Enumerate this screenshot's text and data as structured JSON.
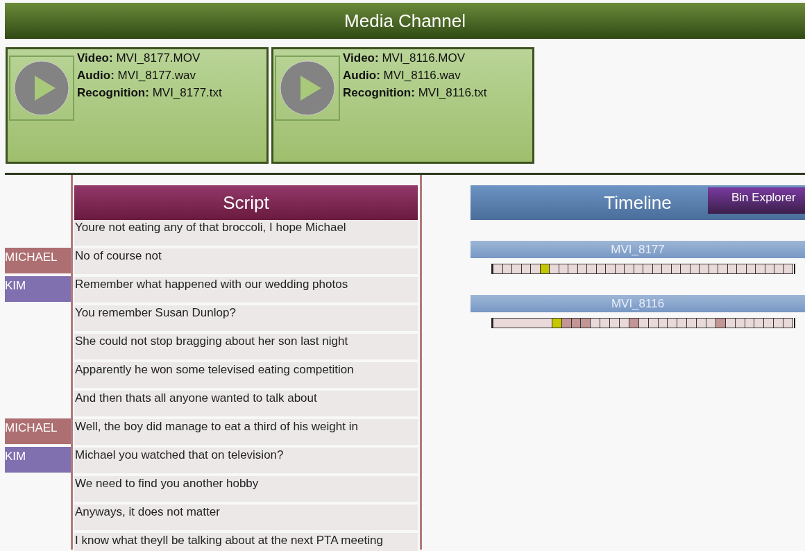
{
  "title": "Media Channel",
  "media": [
    {
      "video": "MVI_8177.MOV",
      "audio": "MVI_8177.wav",
      "recognition": "MVI_8177.txt",
      "video_label": "Video:",
      "audio_label": "Audio:",
      "recognition_label": "Recognition:"
    },
    {
      "video": "MVI_8116.MOV",
      "audio": "MVI_8116.wav",
      "recognition": "MVI_8116.txt",
      "video_label": "Video:",
      "audio_label": "Audio:",
      "recognition_label": "Recognition:"
    }
  ],
  "script": {
    "title": "Script",
    "lines": [
      {
        "text": "Youre not eating any of that broccoli, I hope Michael"
      },
      {
        "speaker": "MICHAEL",
        "color": "#ad6f71",
        "text": "No of course not"
      },
      {
        "speaker": "KIM",
        "color": "#8070b0",
        "text": "Remember what happened with our wedding photos"
      },
      {
        "text": "You remember Susan Dunlop?"
      },
      {
        "text": "She could not stop bragging about her son last night"
      },
      {
        "text": "Apparently he won some televised eating competition"
      },
      {
        "text": "And then thats all anyone wanted to talk about"
      },
      {
        "speaker": "MICHAEL",
        "color": "#ad6f71",
        "text": "Well, the boy did manage to eat a third of his weight in"
      },
      {
        "speaker": "KIM",
        "color": "#8070b0",
        "text": "Michael you watched that on television?"
      },
      {
        "text": "We need to find you another hobby"
      },
      {
        "text": "Anyways, it does not matter"
      },
      {
        "text": "I know what theyll be talking about at the next PTA meeting"
      }
    ]
  },
  "timeline": {
    "title": "Timeline",
    "bin_explorer": "Bin Explorer",
    "tracks": [
      {
        "name": "MVI_8177",
        "segments": [
          {
            "kind": "cell",
            "selected": false,
            "marked": false
          },
          {
            "kind": "cell",
            "selected": false,
            "marked": false
          },
          {
            "kind": "cell",
            "selected": false,
            "marked": false
          },
          {
            "kind": "cell",
            "selected": false,
            "marked": false
          },
          {
            "kind": "cell",
            "selected": false,
            "marked": false
          },
          {
            "kind": "cell",
            "selected": true,
            "marked": false
          },
          {
            "kind": "cell",
            "selected": false,
            "marked": false
          },
          {
            "kind": "cell",
            "selected": false,
            "marked": false
          },
          {
            "kind": "cell",
            "selected": false,
            "marked": false
          },
          {
            "kind": "cell",
            "selected": false,
            "marked": false
          },
          {
            "kind": "cell",
            "selected": false,
            "marked": false
          },
          {
            "kind": "cell",
            "selected": false,
            "marked": false
          },
          {
            "kind": "cell",
            "selected": false,
            "marked": false
          },
          {
            "kind": "cell",
            "selected": false,
            "marked": false
          },
          {
            "kind": "cell",
            "selected": false,
            "marked": false
          },
          {
            "kind": "cell",
            "selected": false,
            "marked": false
          },
          {
            "kind": "cell",
            "selected": false,
            "marked": false
          },
          {
            "kind": "cell",
            "selected": false,
            "marked": false
          },
          {
            "kind": "cell",
            "selected": false,
            "marked": false
          },
          {
            "kind": "cell",
            "selected": false,
            "marked": false
          },
          {
            "kind": "cell",
            "selected": false,
            "marked": false
          },
          {
            "kind": "cell",
            "selected": false,
            "marked": false
          },
          {
            "kind": "cell",
            "selected": false,
            "marked": false
          },
          {
            "kind": "cell",
            "selected": false,
            "marked": false
          },
          {
            "kind": "cell",
            "selected": false,
            "marked": false
          },
          {
            "kind": "cell",
            "selected": false,
            "marked": false
          },
          {
            "kind": "cell",
            "selected": false,
            "marked": false
          },
          {
            "kind": "cell",
            "selected": false,
            "marked": false
          },
          {
            "kind": "cell",
            "selected": false,
            "marked": false
          },
          {
            "kind": "cell",
            "selected": false,
            "marked": false
          },
          {
            "kind": "cell",
            "selected": false,
            "marked": false
          },
          {
            "kind": "cell",
            "selected": false,
            "marked": false
          }
        ]
      },
      {
        "name": "MVI_8116",
        "segments": [
          {
            "kind": "gap",
            "selected": false,
            "marked": false
          },
          {
            "kind": "cell",
            "selected": true,
            "marked": false
          },
          {
            "kind": "cell",
            "selected": false,
            "marked": true
          },
          {
            "kind": "cell",
            "selected": false,
            "marked": true
          },
          {
            "kind": "cell",
            "selected": false,
            "marked": true
          },
          {
            "kind": "cell",
            "selected": false,
            "marked": false
          },
          {
            "kind": "cell",
            "selected": false,
            "marked": false
          },
          {
            "kind": "cell",
            "selected": false,
            "marked": false
          },
          {
            "kind": "cell",
            "selected": false,
            "marked": false
          },
          {
            "kind": "cell",
            "selected": false,
            "marked": true
          },
          {
            "kind": "cell",
            "selected": false,
            "marked": false
          },
          {
            "kind": "cell",
            "selected": false,
            "marked": false
          },
          {
            "kind": "cell",
            "selected": false,
            "marked": false
          },
          {
            "kind": "cell",
            "selected": false,
            "marked": false
          },
          {
            "kind": "cell",
            "selected": false,
            "marked": false
          },
          {
            "kind": "cell",
            "selected": false,
            "marked": false
          },
          {
            "kind": "cell",
            "selected": false,
            "marked": false
          },
          {
            "kind": "cell",
            "selected": false,
            "marked": false
          },
          {
            "kind": "cell",
            "selected": false,
            "marked": true
          },
          {
            "kind": "cell",
            "selected": false,
            "marked": false
          },
          {
            "kind": "cell",
            "selected": false,
            "marked": false
          },
          {
            "kind": "cell",
            "selected": false,
            "marked": false
          },
          {
            "kind": "cell",
            "selected": false,
            "marked": false
          },
          {
            "kind": "cell",
            "selected": false,
            "marked": false
          },
          {
            "kind": "cell",
            "selected": false,
            "marked": false
          },
          {
            "kind": "cell",
            "selected": false,
            "marked": false
          }
        ]
      }
    ]
  }
}
